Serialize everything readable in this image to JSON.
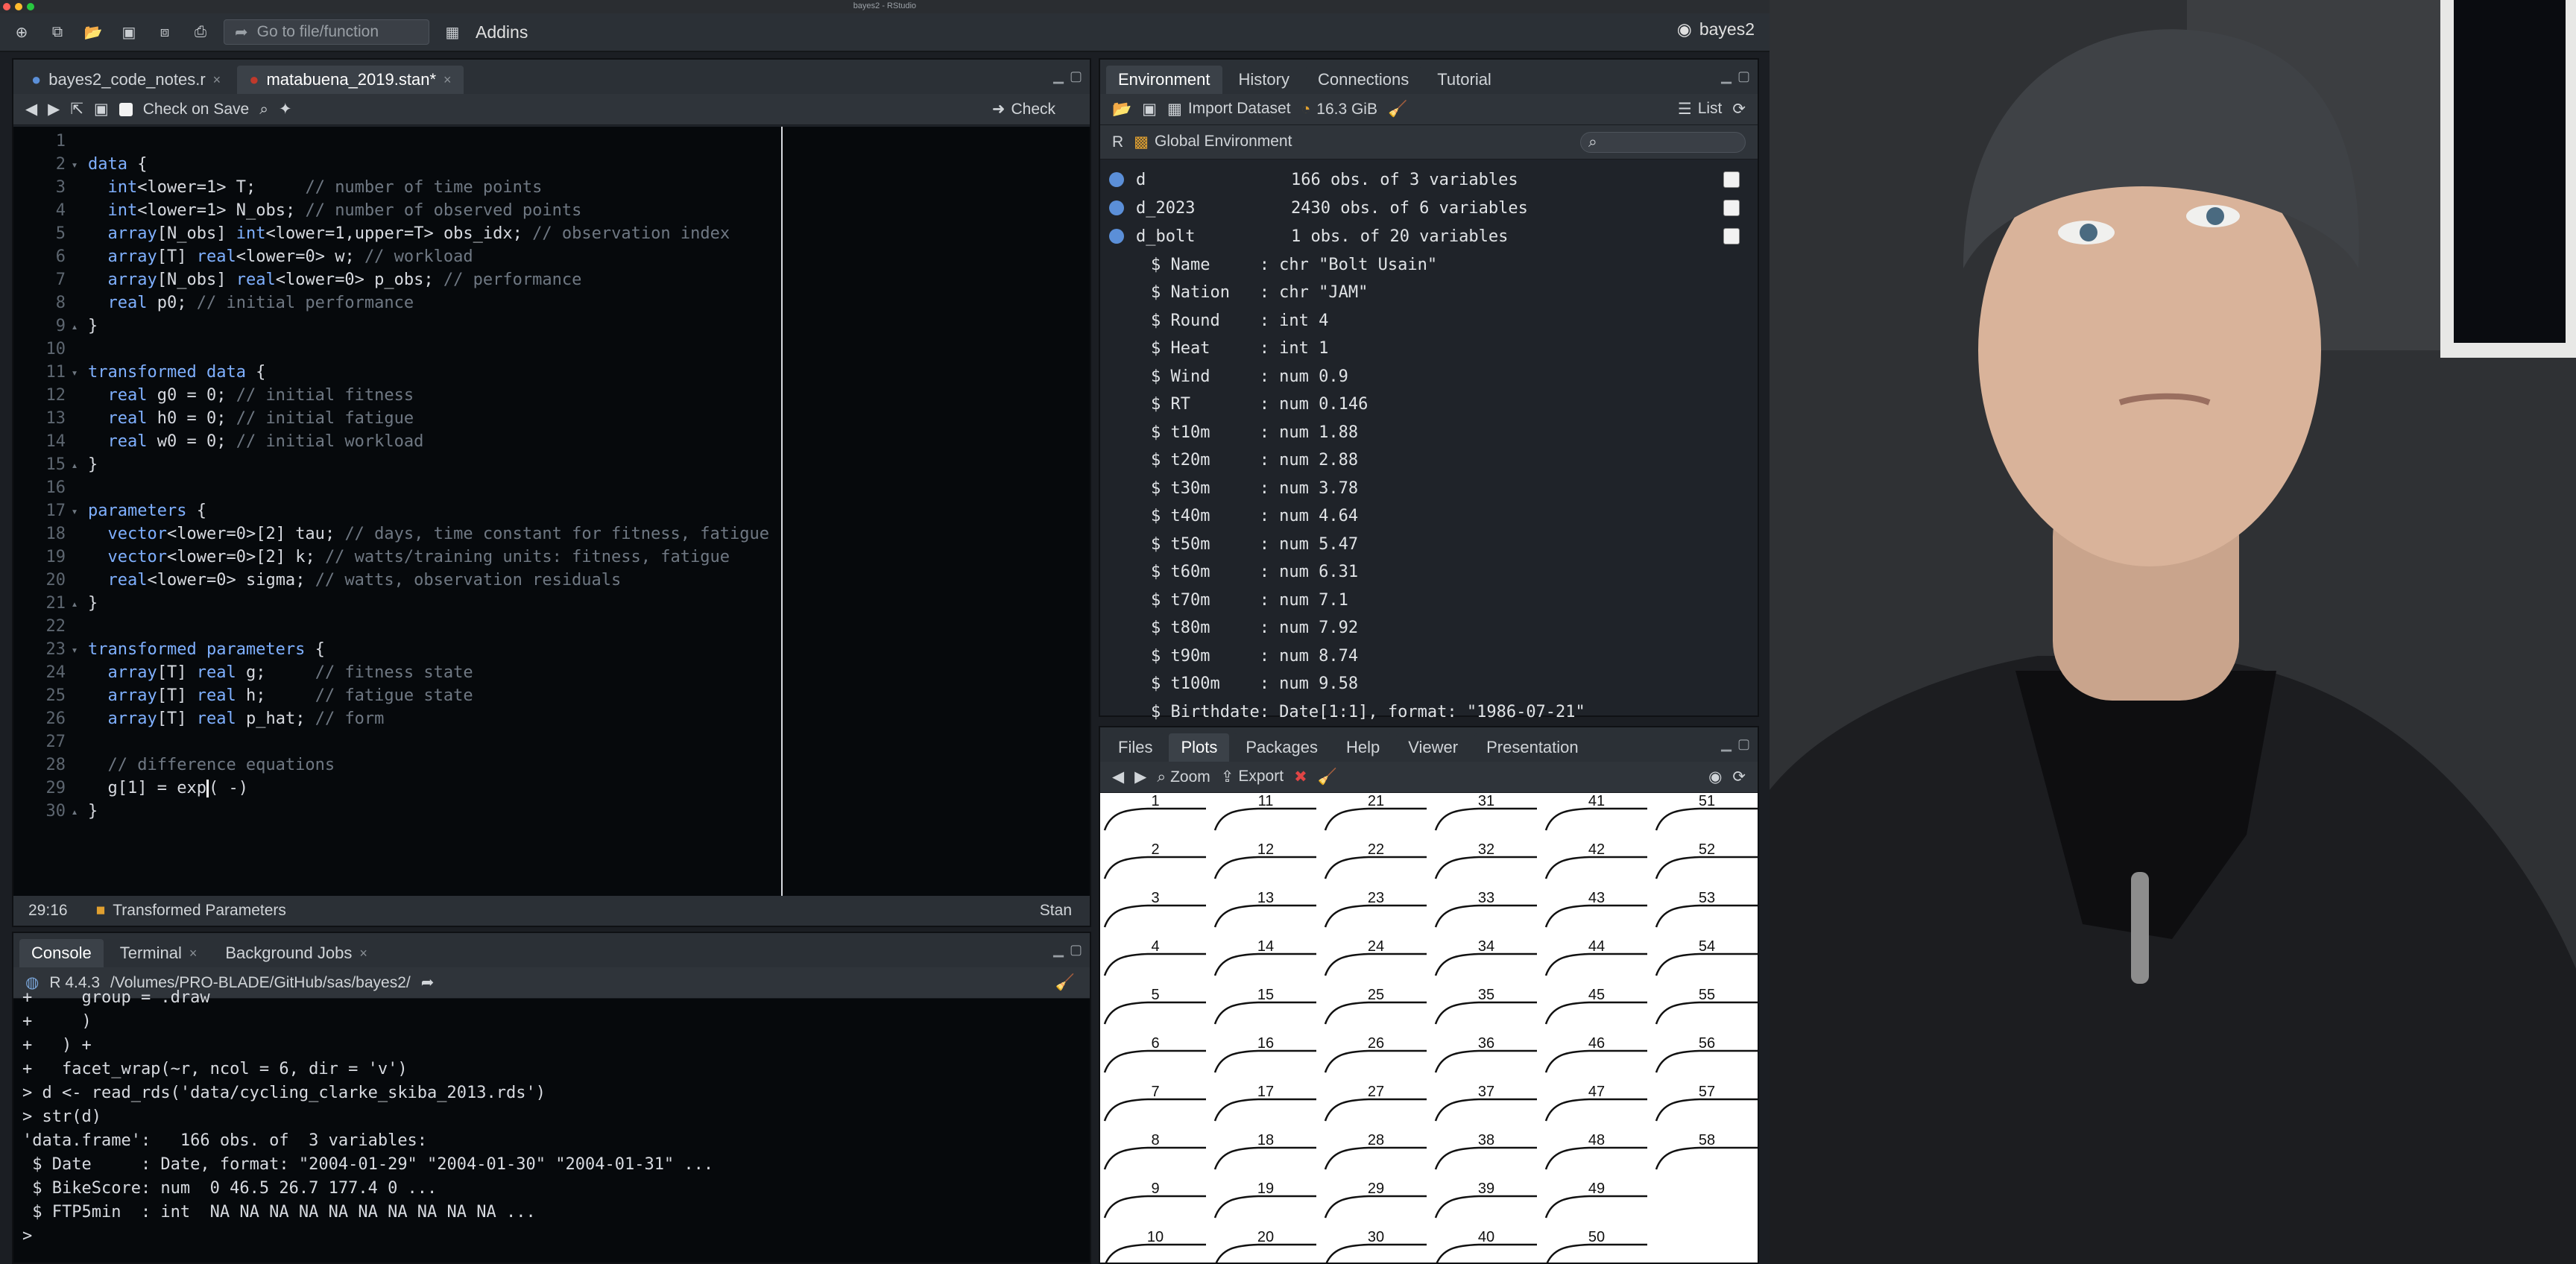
{
  "window": {
    "title": "bayes2 - RStudio"
  },
  "toolbar": {
    "goto_placeholder": "Go to file/function",
    "addins": "Addins",
    "project": "bayes2"
  },
  "source": {
    "tabs": [
      {
        "label": "bayes2_code_notes.r"
      },
      {
        "label": "matabuena_2019.stan*"
      }
    ],
    "check_on_save": "Check on Save",
    "check": "Check",
    "lines": [
      {
        "n": "1",
        "text": ""
      },
      {
        "n": "2",
        "text": "data {"
      },
      {
        "n": "3",
        "text": "  int<lower=1> T;     // number of time points"
      },
      {
        "n": "4",
        "text": "  int<lower=1> N_obs; // number of observed points"
      },
      {
        "n": "5",
        "text": "  array[N_obs] int<lower=1,upper=T> obs_idx; // observation index"
      },
      {
        "n": "6",
        "text": "  array[T] real<lower=0> w; // workload"
      },
      {
        "n": "7",
        "text": "  array[N_obs] real<lower=0> p_obs; // performance"
      },
      {
        "n": "8",
        "text": "  real p0; // initial performance"
      },
      {
        "n": "9",
        "text": "}"
      },
      {
        "n": "10",
        "text": ""
      },
      {
        "n": "11",
        "text": "transformed data {"
      },
      {
        "n": "12",
        "text": "  real g0 = 0; // initial fitness"
      },
      {
        "n": "13",
        "text": "  real h0 = 0; // initial fatigue"
      },
      {
        "n": "14",
        "text": "  real w0 = 0; // initial workload"
      },
      {
        "n": "15",
        "text": "}"
      },
      {
        "n": "16",
        "text": ""
      },
      {
        "n": "17",
        "text": "parameters {"
      },
      {
        "n": "18",
        "text": "  vector<lower=0>[2] tau; // days, time constant for fitness, fatigue"
      },
      {
        "n": "19",
        "text": "  vector<lower=0>[2] k; // watts/training units: fitness, fatigue"
      },
      {
        "n": "20",
        "text": "  real<lower=0> sigma; // watts, observation residuals"
      },
      {
        "n": "21",
        "text": "}"
      },
      {
        "n": "22",
        "text": ""
      },
      {
        "n": "23",
        "text": "transformed parameters {"
      },
      {
        "n": "24",
        "text": "  array[T] real g;     // fitness state"
      },
      {
        "n": "25",
        "text": "  array[T] real h;     // fatigue state"
      },
      {
        "n": "26",
        "text": "  array[T] real p_hat; // form"
      },
      {
        "n": "27",
        "text": ""
      },
      {
        "n": "28",
        "text": "  // difference equations"
      },
      {
        "n": "29",
        "text": "  g[1] = exp( -)"
      },
      {
        "n": "30",
        "text": "}"
      }
    ],
    "status": {
      "position": "29:16",
      "scope": "Transformed Parameters",
      "filetype": "Stan"
    }
  },
  "console": {
    "tabs": [
      {
        "label": "Console"
      },
      {
        "label": "Terminal"
      },
      {
        "label": "Background Jobs"
      }
    ],
    "r_version": "R 4.4.3",
    "path": "/Volumes/PRO-BLADE/GitHub/sas/bayes2/",
    "lines": [
      "+     group = .draw",
      "+     )",
      "+   ) +",
      "+   facet_wrap(~r, ncol = 6, dir = 'v')",
      "> d <- read_rds('data/cycling_clarke_skiba_2013.rds')",
      "> str(d)",
      "'data.frame':   166 obs. of  3 variables:",
      " $ Date     : Date, format: \"2004-01-29\" \"2004-01-30\" \"2004-01-31\" ...",
      " $ BikeScore: num  0 46.5 26.7 177.4 0 ...",
      " $ FTP5min  : int  NA NA NA NA NA NA NA NA NA NA ...",
      "> "
    ]
  },
  "environment": {
    "tabs": [
      {
        "label": "Environment"
      },
      {
        "label": "History"
      },
      {
        "label": "Connections"
      },
      {
        "label": "Tutorial"
      }
    ],
    "import_dataset": "Import Dataset",
    "memory": "16.3 GiB",
    "view_mode": "List",
    "language": "R",
    "scope": "Global Environment",
    "objects": [
      {
        "name": "d",
        "value": "166 obs. of 3 variables"
      },
      {
        "name": "d_2023",
        "value": "2430 obs. of 6 variables"
      },
      {
        "name": "d_bolt",
        "value": "1 obs. of 20 variables"
      }
    ],
    "structure": [
      "$ Name     : chr \"Bolt Usain\"",
      "$ Nation   : chr \"JAM\"",
      "$ Round    : int 4",
      "$ Heat     : int 1",
      "$ Wind     : num 0.9",
      "$ RT       : num 0.146",
      "$ t10m     : num 1.88",
      "$ t20m     : num 2.88",
      "$ t30m     : num 3.78",
      "$ t40m     : num 4.64",
      "$ t50m     : num 5.47",
      "$ t60m     : num 6.31",
      "$ t70m     : num 7.1",
      "$ t80m     : num 7.92",
      "$ t90m     : num 8.74",
      "$ t100m    : num 9.58",
      "$ Birthdate: Date[1:1], format: \"1986-07-21\""
    ]
  },
  "plots": {
    "tabs": [
      {
        "label": "Files"
      },
      {
        "label": "Plots"
      },
      {
        "label": "Packages"
      },
      {
        "label": "Help"
      },
      {
        "label": "Viewer"
      },
      {
        "label": "Presentation"
      }
    ],
    "zoom": "Zoom",
    "export": "Export",
    "facets": [
      [
        "1",
        "2",
        "3",
        "4",
        "5",
        "6",
        "7",
        "8",
        "9",
        "10"
      ],
      [
        "11",
        "12",
        "13",
        "14",
        "15",
        "16",
        "17",
        "18",
        "19",
        "20"
      ],
      [
        "21",
        "22",
        "23",
        "24",
        "25",
        "26",
        "27",
        "28",
        "29",
        "30"
      ],
      [
        "31",
        "32",
        "33",
        "34",
        "35",
        "36",
        "37",
        "38",
        "39",
        "40"
      ],
      [
        "41",
        "42",
        "43",
        "44",
        "45",
        "46",
        "47",
        "48",
        "49",
        "50"
      ],
      [
        "51",
        "52",
        "53",
        "54",
        "55",
        "56",
        "57",
        "58"
      ]
    ]
  },
  "colors": {
    "keyword": "#7fb0ff",
    "comment": "#6f7883",
    "accent": "#5b8fd8"
  }
}
